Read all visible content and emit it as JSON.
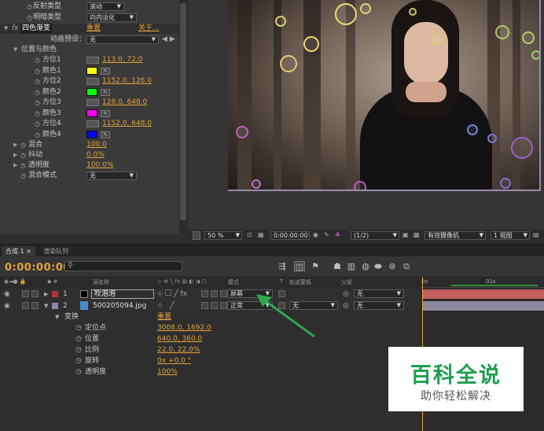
{
  "effects": {
    "rows": [
      {
        "label": "反射类型",
        "value": "滚动"
      },
      {
        "label": "明暗类型",
        "value": "向内淡化"
      },
      {
        "fx": "fx",
        "label": "四色渐变",
        "reset": "重置",
        "about": "关于..."
      },
      {
        "label": "动画预设：",
        "value": "无"
      },
      {
        "label": "位置与颜色"
      },
      {
        "label": "方位1",
        "value": "113.0, 72.0"
      },
      {
        "label": "颜色1",
        "color": "#ffff00"
      },
      {
        "label": "方位2",
        "value": "1152.0, 126.0"
      },
      {
        "label": "颜色2",
        "color": "#00ff00"
      },
      {
        "label": "方位3",
        "value": "128.0, 648.0"
      },
      {
        "label": "颜色3",
        "color": "#ff00ff"
      },
      {
        "label": "方位4",
        "value": "1152.0, 648.0"
      },
      {
        "label": "颜色4",
        "color": "#0000ff"
      },
      {
        "label": "混合",
        "value": "100.0"
      },
      {
        "label": "抖动",
        "value": "0.0%"
      },
      {
        "label": "透明度",
        "value": "100.0%"
      },
      {
        "label": "混合模式",
        "value": "无"
      }
    ]
  },
  "viewer": {
    "zoom": "50 %",
    "timecode": "0:00:00:00",
    "resolution": "(1/2)",
    "camera": "有效摄像机",
    "views": "1 视图"
  },
  "timeline": {
    "tabs": [
      "合成 1",
      "渲染队列"
    ],
    "timecode": "0:00:00:00",
    "search_placeholder": "",
    "columns": {
      "source": "源名称",
      "mode": "模式",
      "t": "T",
      "trkmat": "轨道蒙板",
      "parent": "父级"
    },
    "ruler": [
      "0s",
      "01s"
    ],
    "layers": [
      {
        "num": "1",
        "name": "吹泡泡",
        "color": "#b83030",
        "mode": "屏幕",
        "trkmat": "",
        "parent": "无",
        "bar": "#c46060"
      },
      {
        "num": "2",
        "name": "500205094.jpg",
        "color": "#8a8aa8",
        "mode": "正常",
        "trkmat": "无",
        "parent": "无",
        "bar": "#8a8a9a"
      }
    ],
    "transform": {
      "label": "变换",
      "reset": "重置",
      "props": [
        {
          "label": "定位点",
          "value": "3008.0, 1692.0"
        },
        {
          "label": "位置",
          "value": "640.0, 360.0"
        },
        {
          "label": "比例",
          "value": "22.0, 22.0%"
        },
        {
          "label": "旋转",
          "value": "0x +0.0 °"
        },
        {
          "label": "透明度",
          "value": "100%"
        }
      ]
    }
  },
  "watermark": {
    "title": "百科全说",
    "subtitle": "助你轻松解决"
  },
  "colors": {
    "accent": "#e2a23a",
    "watermark_green": "#1e9f4e",
    "arrow": "#2fa84f"
  }
}
